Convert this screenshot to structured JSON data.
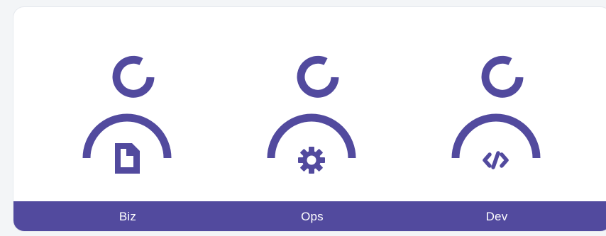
{
  "roles": [
    {
      "label": "Biz",
      "icon": "document-icon"
    },
    {
      "label": "Ops",
      "icon": "gear-icon"
    },
    {
      "label": "Dev",
      "icon": "code-icon"
    }
  ],
  "colors": {
    "accent": "#524a9e",
    "footer_text": "#ffffff",
    "card_background": "#ffffff",
    "page_background": "#f3f5f7"
  }
}
